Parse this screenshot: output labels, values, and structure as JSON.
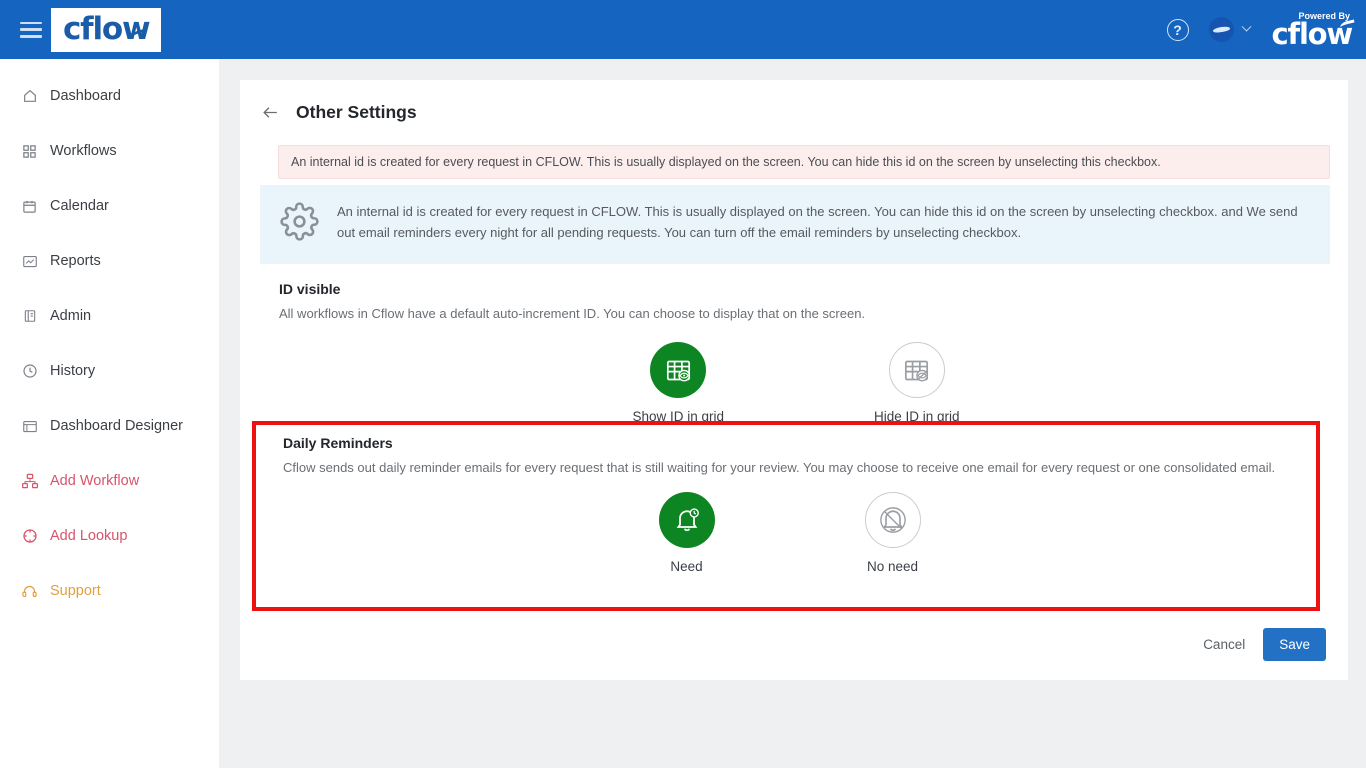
{
  "topbar": {
    "menu_icon": "hamburger-icon",
    "logo_text": "cflow",
    "help_icon": "?",
    "avatar_icon": "user-avatar",
    "dropdown_icon": "chevron-down-icon",
    "powered_label": "Powered By",
    "powered_logo": "cflow",
    "bg_color": "#1565c0"
  },
  "sidebar": {
    "items": [
      {
        "label": "Dashboard",
        "icon": "home-icon",
        "color": "#3b3f45"
      },
      {
        "label": "Workflows",
        "icon": "grid-icon",
        "color": "#3b3f45"
      },
      {
        "label": "Calendar",
        "icon": "calendar-icon",
        "color": "#3b3f45"
      },
      {
        "label": "Reports",
        "icon": "report-icon",
        "color": "#3b3f45"
      },
      {
        "label": "Admin",
        "icon": "admin-book-icon",
        "color": "#3b3f45"
      },
      {
        "label": "History",
        "icon": "clock-history-icon",
        "color": "#3b3f45"
      },
      {
        "label": "Dashboard Designer",
        "icon": "dashboard-designer-icon",
        "color": "#3b3f45"
      },
      {
        "label": "Add Workflow",
        "icon": "add-workflow-icon",
        "color": "#d6556b"
      },
      {
        "label": "Add Lookup",
        "icon": "add-lookup-icon",
        "color": "#d6556b"
      },
      {
        "label": "Support",
        "icon": "headset-icon",
        "color": "#e2a03f"
      }
    ]
  },
  "main": {
    "back_icon": "back-arrow-icon",
    "title": "Other Settings",
    "alert": "An internal id is created for every request in CFLOW. This is usually displayed on the screen. You can hide this id on the screen by unselecting this checkbox.",
    "info_icon": "gear-icon",
    "info": "An internal id is created for every request in CFLOW. This is usually displayed on the screen. You can hide this id on the screen by unselecting checkbox. and We send out email reminders every night for all pending requests. You can turn off the email reminders by unselecting checkbox.",
    "id_visible": {
      "title": "ID visible",
      "description": "All workflows in Cflow have a default auto-increment ID. You can choose to display that on the screen.",
      "options": [
        {
          "label": "Show ID in grid",
          "icon": "grid-eye-icon",
          "selected": true
        },
        {
          "label": "Hide ID in grid",
          "icon": "grid-eye-off-icon",
          "selected": false
        }
      ]
    },
    "daily_reminders": {
      "title": "Daily Reminders",
      "description": "Cflow sends out daily reminder emails for every request that is still waiting for your review. You may choose to receive one email for every request or one consolidated email.",
      "highlight_color": "#ee1111",
      "options": [
        {
          "label": "Need",
          "icon": "bell-clock-icon",
          "selected": true
        },
        {
          "label": "No need",
          "icon": "bell-off-icon",
          "selected": false
        }
      ]
    },
    "cancel_label": "Cancel",
    "save_label": "Save",
    "save_color": "#2271c4"
  }
}
